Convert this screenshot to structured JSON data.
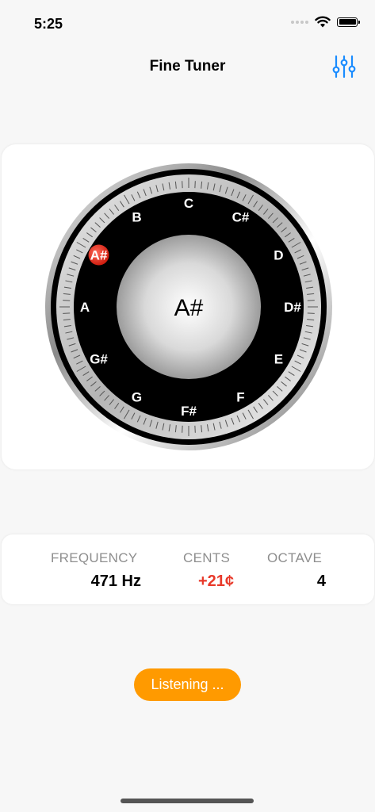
{
  "status_bar": {
    "time": "5:25"
  },
  "nav": {
    "title": "Fine Tuner"
  },
  "tuner": {
    "current_note": "A#",
    "notes": [
      "C",
      "C#",
      "D",
      "D#",
      "E",
      "F",
      "F#",
      "G",
      "G#",
      "A",
      "A#",
      "B"
    ],
    "active_note": "A#",
    "colors": {
      "accent_red": "#e8392a",
      "dial_black": "#000000"
    }
  },
  "readout": {
    "frequency_label": "FREQUENCY",
    "frequency_value": "471 Hz",
    "cents_label": "CENTS",
    "cents_value": "+21¢",
    "octave_label": "OCTAVE",
    "octave_value": "4"
  },
  "listen_button": {
    "label": "Listening ..."
  },
  "colors": {
    "orange": "#ff9a00",
    "blue": "#1a8cff",
    "cents_red": "#e8392a"
  }
}
